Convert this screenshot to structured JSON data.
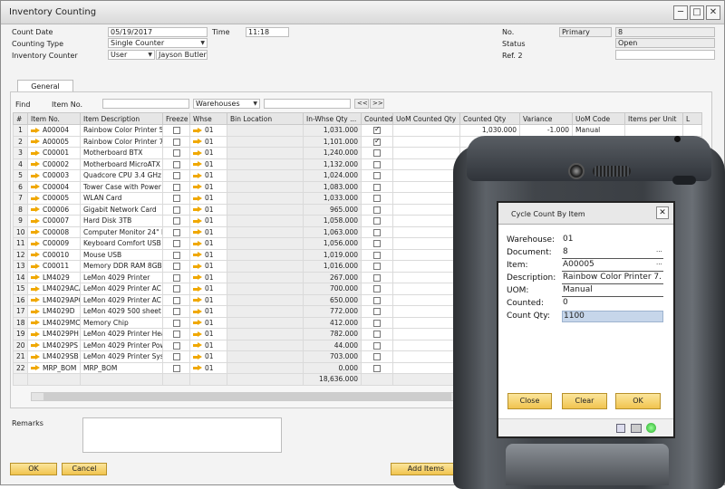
{
  "window": {
    "title": "Inventory Counting",
    "controls": [
      "─",
      "□",
      "✕"
    ]
  },
  "header": {
    "count_date_label": "Count Date",
    "count_date": "05/19/2017",
    "time_label": "Time",
    "time": "11:18",
    "counting_type_label": "Counting Type",
    "counting_type": "Single Counter",
    "inventory_counter_label": "Inventory Counter",
    "counter_type": "User",
    "counter_name": "Jayson Butler",
    "no_label": "No.",
    "no_series": "Primary",
    "no_value": "8",
    "status_label": "Status",
    "status_value": "Open",
    "ref2_label": "Ref. 2",
    "ref2_value": ""
  },
  "tabs": {
    "general": "General"
  },
  "find": {
    "find_label": "Find",
    "item_no_label": "Item No.",
    "warehouses": "Warehouses",
    "prev": "<<",
    "next": ">>"
  },
  "grid": {
    "headers": [
      "#",
      "Item No.",
      "Item Description",
      "Freeze",
      "Whse",
      "Bin Location",
      "In-Whse Qty ...",
      "Counted",
      "UoM Counted Qty",
      "Counted Qty",
      "Variance",
      "UoM Code",
      "Items per Unit",
      "L"
    ],
    "rows": [
      {
        "n": "1",
        "item": "A00004",
        "desc": "Rainbow Color Printer 5.0",
        "whse": "01",
        "qty": "1,031.000",
        "counted": true,
        "counted_qty": "1,030.000",
        "variance": "-1.000",
        "uom": "Manual"
      },
      {
        "n": "2",
        "item": "A00005",
        "desc": "Rainbow Color Printer 7.5",
        "whse": "01",
        "qty": "1,101.000",
        "counted": true,
        "counted_qty": "1,100.000",
        "variance": "-1.000",
        "uom": "Manual"
      },
      {
        "n": "3",
        "item": "C00001",
        "desc": "Motherboard BTX",
        "whse": "01",
        "qty": "1,240.000",
        "counted": false
      },
      {
        "n": "4",
        "item": "C00002",
        "desc": "Motherboard MicroATX",
        "whse": "01",
        "qty": "1,132.000",
        "counted": false
      },
      {
        "n": "5",
        "item": "C00003",
        "desc": "Quadcore CPU 3.4 GHz",
        "whse": "01",
        "qty": "1,024.000",
        "counted": false
      },
      {
        "n": "6",
        "item": "C00004",
        "desc": "Tower Case with Power s",
        "whse": "01",
        "qty": "1,083.000",
        "counted": false
      },
      {
        "n": "7",
        "item": "C00005",
        "desc": "WLAN Card",
        "whse": "01",
        "qty": "1,033.000",
        "counted": false
      },
      {
        "n": "8",
        "item": "C00006",
        "desc": "Gigabit Network Card",
        "whse": "01",
        "qty": "965.000",
        "counted": false
      },
      {
        "n": "9",
        "item": "C00007",
        "desc": "Hard Disk 3TB",
        "whse": "01",
        "qty": "1,058.000",
        "counted": false
      },
      {
        "n": "10",
        "item": "C00008",
        "desc": "Computer Monitor 24\" HD",
        "whse": "01",
        "qty": "1,063.000",
        "counted": false
      },
      {
        "n": "11",
        "item": "C00009",
        "desc": "Keyboard Comfort USB",
        "whse": "01",
        "qty": "1,056.000",
        "counted": false
      },
      {
        "n": "12",
        "item": "C00010",
        "desc": "Mouse USB",
        "whse": "01",
        "qty": "1,019.000",
        "counted": false
      },
      {
        "n": "13",
        "item": "C00011",
        "desc": "Memory DDR RAM 8GB",
        "whse": "01",
        "qty": "1,016.000",
        "counted": false
      },
      {
        "n": "14",
        "item": "LM4029",
        "desc": "LeMon 4029 Printer",
        "whse": "01",
        "qty": "267.000",
        "counted": false
      },
      {
        "n": "15",
        "item": "LM4029ACA",
        "desc": "LeMon 4029 Printer AC A",
        "whse": "01",
        "qty": "700.000",
        "counted": false
      },
      {
        "n": "16",
        "item": "LM4029APC",
        "desc": "LeMon 4029 Printer AC P",
        "whse": "01",
        "qty": "650.000",
        "counted": false
      },
      {
        "n": "17",
        "item": "LM4029D",
        "desc": "LeMon 4029 500 sheet pap",
        "whse": "01",
        "qty": "772.000",
        "counted": false
      },
      {
        "n": "18",
        "item": "LM4029MC",
        "desc": "Memory Chip",
        "whse": "01",
        "qty": "412.000",
        "counted": false
      },
      {
        "n": "19",
        "item": "LM4029PH",
        "desc": "LeMon 4029 Printer Head",
        "whse": "01",
        "qty": "782.000",
        "counted": false
      },
      {
        "n": "20",
        "item": "LM4029PS",
        "desc": "LeMon 4029 Printer Powe",
        "whse": "01",
        "qty": "44.000",
        "counted": false
      },
      {
        "n": "21",
        "item": "LM4029SB",
        "desc": "LeMon 4029 Printer Syste",
        "whse": "01",
        "qty": "703.000",
        "counted": false
      },
      {
        "n": "22",
        "item": "MRP_BOM",
        "desc": "MRP_BOM",
        "whse": "01",
        "qty": "0.000",
        "counted": false
      }
    ],
    "total": "18,636.000"
  },
  "footer": {
    "remarks_label": "Remarks",
    "ok": "OK",
    "cancel": "Cancel",
    "add_items": "Add Items"
  },
  "dialog": {
    "title": "Cycle Count By Item",
    "close_x": "✕",
    "warehouse_label": "Warehouse:",
    "warehouse": "01",
    "document_label": "Document:",
    "document": "8",
    "item_label": "Item:",
    "item": "A00005",
    "description_label": "Description:",
    "description": "Rainbow Color Printer 7.",
    "uom_label": "UOM:",
    "uom": "Manual",
    "counted_label": "Counted:",
    "counted": "0",
    "count_qty_label": "Count Qty:",
    "count_qty": "1100",
    "ellipsis": "...",
    "btn_close": "Close",
    "btn_clear": "Clear",
    "btn_ok": "OK"
  },
  "colors": {
    "accent_button": "#f1c44f",
    "arrow": "#f0a800",
    "highlight": "#c6d6ea"
  }
}
